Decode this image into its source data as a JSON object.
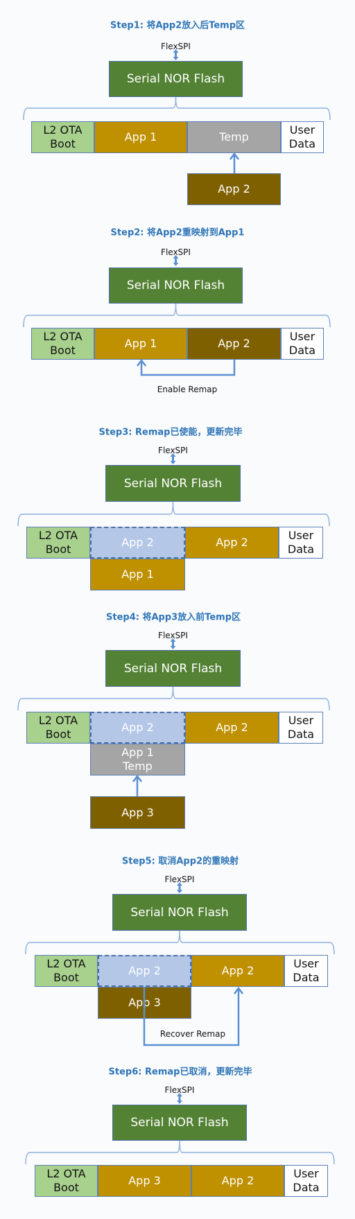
{
  "colors": {
    "title": "#2e75b6",
    "flash": "#548235",
    "boot": "#a9d18e",
    "app": "#bf9000",
    "app_new": "#7f6000",
    "temp": "#a5a5a5",
    "remapped": "#b4c7e7",
    "user": "#ffffff",
    "line": "#5b8fd0"
  },
  "steps": [
    {
      "title": "Step1: 将App2放入后Temp区",
      "flexspi": "FlexSPI",
      "flash": "Serial NOR Flash",
      "segments": [
        {
          "label": "L2 OTA\nBoot",
          "kind": "boot"
        },
        {
          "label": "App 1",
          "kind": "app"
        },
        {
          "label": "Temp",
          "kind": "temp"
        },
        {
          "label": "User\nData",
          "kind": "user"
        }
      ],
      "extra_boxes": [
        {
          "label": "App 2",
          "kind": "app_new"
        }
      ]
    },
    {
      "title": "Step2: 将App2重映射到App1",
      "flexspi": "FlexSPI",
      "flash": "Serial NOR Flash",
      "segments": [
        {
          "label": "L2 OTA\nBoot",
          "kind": "boot"
        },
        {
          "label": "App 1",
          "kind": "app"
        },
        {
          "label": "App 2",
          "kind": "app_new"
        },
        {
          "label": "User\nData",
          "kind": "user"
        }
      ],
      "remap_label": "Enable Remap"
    },
    {
      "title": "Step3: Remap已使能，更新完毕",
      "flexspi": "FlexSPI",
      "flash": "Serial NOR Flash",
      "segments": [
        {
          "label": "L2 OTA\nBoot",
          "kind": "boot"
        },
        {
          "label": "App 2",
          "kind": "remapped"
        },
        {
          "label": "App 2",
          "kind": "app"
        },
        {
          "label": "User\nData",
          "kind": "user"
        }
      ],
      "extra_boxes": [
        {
          "label": "App 1",
          "kind": "app"
        }
      ]
    },
    {
      "title": "Step4: 将App3放入前Temp区",
      "flexspi": "FlexSPI",
      "flash": "Serial NOR Flash",
      "segments": [
        {
          "label": "L2 OTA\nBoot",
          "kind": "boot"
        },
        {
          "label": "App 2",
          "kind": "remapped"
        },
        {
          "label": "App 2",
          "kind": "app"
        },
        {
          "label": "User\nData",
          "kind": "user"
        }
      ],
      "extra_boxes": [
        {
          "label": "App 1\nTemp",
          "kind": "temp"
        },
        {
          "label": "App 3",
          "kind": "app_new"
        }
      ]
    },
    {
      "title": "Step5: 取消App2的重映射",
      "flexspi": "FlexSPI",
      "flash": "Serial NOR Flash",
      "segments": [
        {
          "label": "L2 OTA\nBoot",
          "kind": "boot"
        },
        {
          "label": "App 2",
          "kind": "remapped"
        },
        {
          "label": "App 2",
          "kind": "app"
        },
        {
          "label": "User\nData",
          "kind": "user"
        }
      ],
      "extra_boxes": [
        {
          "label": "App 3",
          "kind": "app_new"
        }
      ],
      "remap_label": "Recover Remap"
    },
    {
      "title": "Step6: Remap已取消，更新完毕",
      "flexspi": "FlexSPI",
      "flash": "Serial NOR Flash",
      "segments": [
        {
          "label": "L2 OTA\nBoot",
          "kind": "boot"
        },
        {
          "label": "App 3",
          "kind": "app"
        },
        {
          "label": "App 2",
          "kind": "app"
        },
        {
          "label": "User\nData",
          "kind": "user"
        }
      ]
    }
  ]
}
